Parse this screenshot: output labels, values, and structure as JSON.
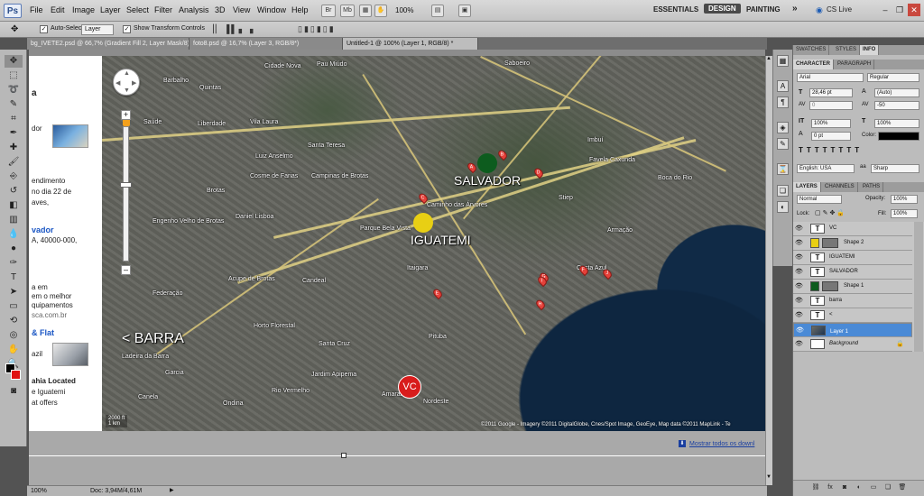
{
  "app": {
    "logo": "Ps"
  },
  "menu": [
    "File",
    "Edit",
    "Image",
    "Layer",
    "Select",
    "Filter",
    "Analysis",
    "3D",
    "View",
    "Window",
    "Help"
  ],
  "menubar_buttons": [
    "Br",
    "Mb"
  ],
  "zoom_menubar": "100%",
  "workspaces": {
    "essentials": "ESSENTIALS",
    "design": "DESIGN",
    "painting": "PAINTING",
    "more": "»"
  },
  "cs_live": "CS Live",
  "options": {
    "auto_select_label": "Auto-Select:",
    "auto_select_value": "Layer",
    "show_transform": "Show Transform Controls"
  },
  "tabs": [
    "bg_IVETE2.psd @ 66,7% (Gradient Fill 2, Layer Mask/8) *",
    "foto8.psd @ 16,7% (Layer 3, RGB/8*)",
    "Untitled-1 @ 100% (Layer 1, RGB/8) *"
  ],
  "web": {
    "lines": [
      {
        "t": "a",
        "style": "bold"
      },
      {
        "t": "dor",
        "style": ""
      },
      {
        "t": "endimento",
        "style": ""
      },
      {
        "t": "no dia 22 de",
        "style": ""
      },
      {
        "t": "aves,",
        "style": ""
      },
      {
        "t": "vador",
        "style": "blue"
      },
      {
        "t": "A, 40000-000,",
        "style": ""
      },
      {
        "t": "a em",
        "style": ""
      },
      {
        "t": "em o melhor",
        "style": ""
      },
      {
        "t": "quipamentos",
        "style": ""
      },
      {
        "t": "sca.com.br",
        "style": ""
      },
      {
        "t": "& Flat",
        "style": "blue"
      },
      {
        "t": "azil",
        "style": ""
      },
      {
        "t": "ahia Located",
        "style": "bold"
      },
      {
        "t": "e Iguatemi",
        "style": ""
      },
      {
        "t": "at offers",
        "style": ""
      }
    ]
  },
  "map": {
    "big_labels": {
      "salvador": "SALVADOR",
      "iguatemi": "IGUATEMI",
      "barra": "< BARRA",
      "vc": "VC"
    },
    "colors": {
      "salvador_marker": "#0d5c1e",
      "iguatemi_marker": "#e8cf14",
      "vc_marker": "#d81c1c"
    },
    "areas": [
      "Cidade Nova",
      "Pau Miúdo",
      "Barbalho",
      "Quintas",
      "Saboeiro",
      "Saúde",
      "Liberdade",
      "Vila Laura",
      "Luiz Anselmo",
      "Cosme de Farias",
      "Santa Teresa",
      "Campinas de Brotas",
      "Brotas",
      "Engenho Velho de Brotas",
      "Daniel Lisboa",
      "Acupe de Brotas",
      "Parque Bela Vista",
      "Federação",
      "Candeal",
      "Horto Florestal",
      "Santa Cruz",
      "Pituba",
      "Amaralina",
      "Nordeste",
      "Ondina",
      "Rio Vermelho",
      "Stiep",
      "Imbuí",
      "Caminho das Árvores",
      "Costa Azul",
      "Armação",
      "Boca do Rio",
      "Itaigara",
      "Favela Caxunda",
      "Ladeira da Barra",
      "Garcia",
      "Jardim Apipema",
      "Canela",
      "Rio Vermelho"
    ],
    "pins": [
      "A",
      "B",
      "C",
      "D",
      "E",
      "F",
      "G",
      "H",
      "I",
      "J"
    ],
    "scale_top": "2000 ft",
    "scale_bottom": "1 km",
    "copyright": "©2011 Google - Imagery ©2011 DigitalGlobe, Cnes/Spot Image, GeoEye, Map data ©2011 MapLink - Te"
  },
  "below": {
    "mostrar": "Mostrar todos os downl"
  },
  "status": {
    "zoom": "100%",
    "doc": "Doc: 3,94M/4,61M"
  },
  "panels": {
    "top_tabs": [
      "SWATCHES",
      "STYLES",
      "INFO"
    ],
    "char_tabs": [
      "CHARACTER",
      "PARAGRAPH"
    ],
    "font_family": "Arial",
    "font_style": "Regular",
    "font_size": "28,46 pt",
    "leading": "(Auto)",
    "kerning": "0",
    "tracking": "-50",
    "vscale": "100%",
    "hscale": "100%",
    "baseline": "0 pt",
    "color_label": "Color:",
    "language": "English: USA",
    "aa": "Sharp",
    "layer_tabs": [
      "LAYERS",
      "CHANNELS",
      "PATHS"
    ],
    "blend": "Normal",
    "opacity_label": "Opacity:",
    "opacity": "100%",
    "lock_label": "Lock:",
    "fill_label": "Fill:",
    "fill": "100%",
    "layers": [
      {
        "name": "VC",
        "type": "text"
      },
      {
        "name": "Shape 2",
        "type": "shape",
        "color": "#e8cf14"
      },
      {
        "name": "IGUATEMI",
        "type": "text"
      },
      {
        "name": "SALVADOR",
        "type": "text"
      },
      {
        "name": "Shape 1",
        "type": "shape",
        "color": "#0d5c1e"
      },
      {
        "name": "barra",
        "type": "text"
      },
      {
        "name": "<",
        "type": "text"
      },
      {
        "name": "Layer 1",
        "type": "image",
        "selected": true
      },
      {
        "name": "Background",
        "type": "bg"
      }
    ]
  }
}
